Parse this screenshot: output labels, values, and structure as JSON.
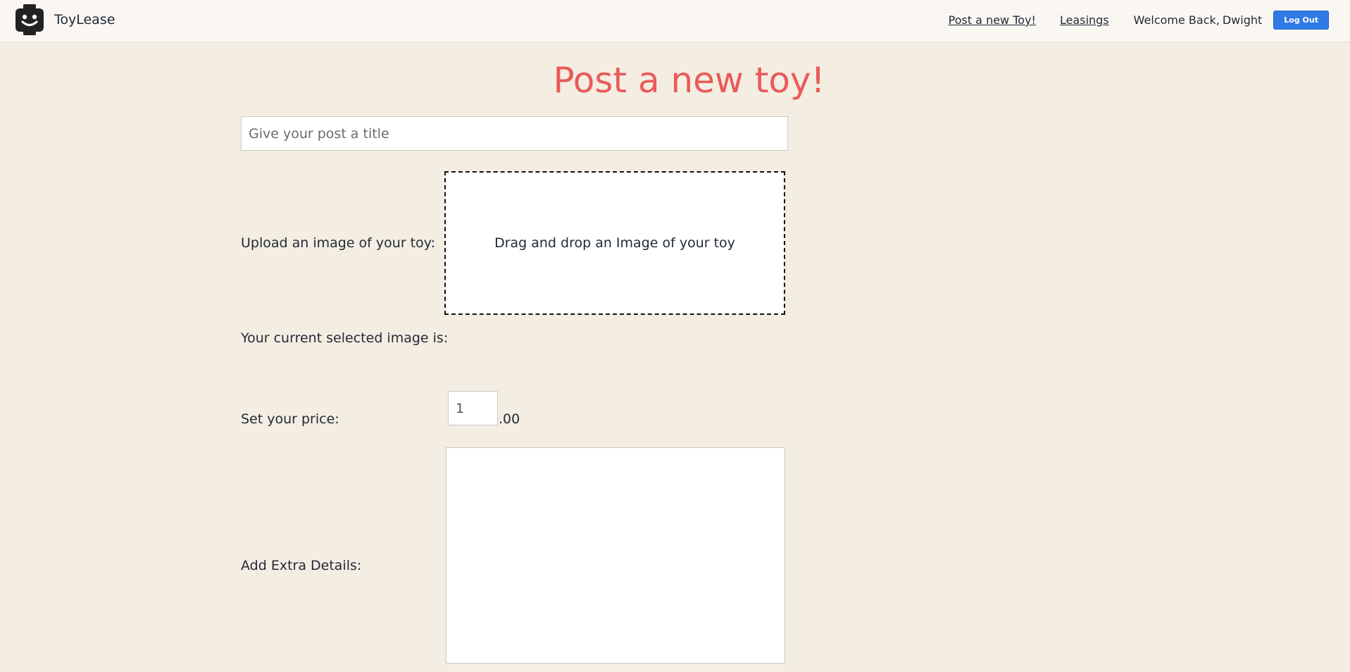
{
  "navbar": {
    "brand_name": "ToyLease",
    "logo_icon": "toy-face-icon",
    "links": {
      "post_new": "Post a new Toy!",
      "leasings": "Leasings"
    },
    "welcome_text": "Welcome Back,",
    "user_name": "Dwight",
    "logout_label": "Log Out"
  },
  "main": {
    "page_title": "Post a new toy!",
    "title_input": {
      "placeholder": "Give your post a title",
      "value": ""
    },
    "upload_label": "Upload an image of your toy:",
    "dropzone_text": "Drag and drop an Image of your toy",
    "current_image_label": "Your current selected image is:",
    "price_label": "Set your price:",
    "price_value": "1",
    "price_suffix": ".00",
    "details_label": "Add Extra Details:",
    "details_value": ""
  },
  "colors": {
    "background": "#f4ede1",
    "navbar_background": "#faf7f2",
    "title_accent": "#ea5a5a",
    "logout_button": "#2f7ae5"
  }
}
